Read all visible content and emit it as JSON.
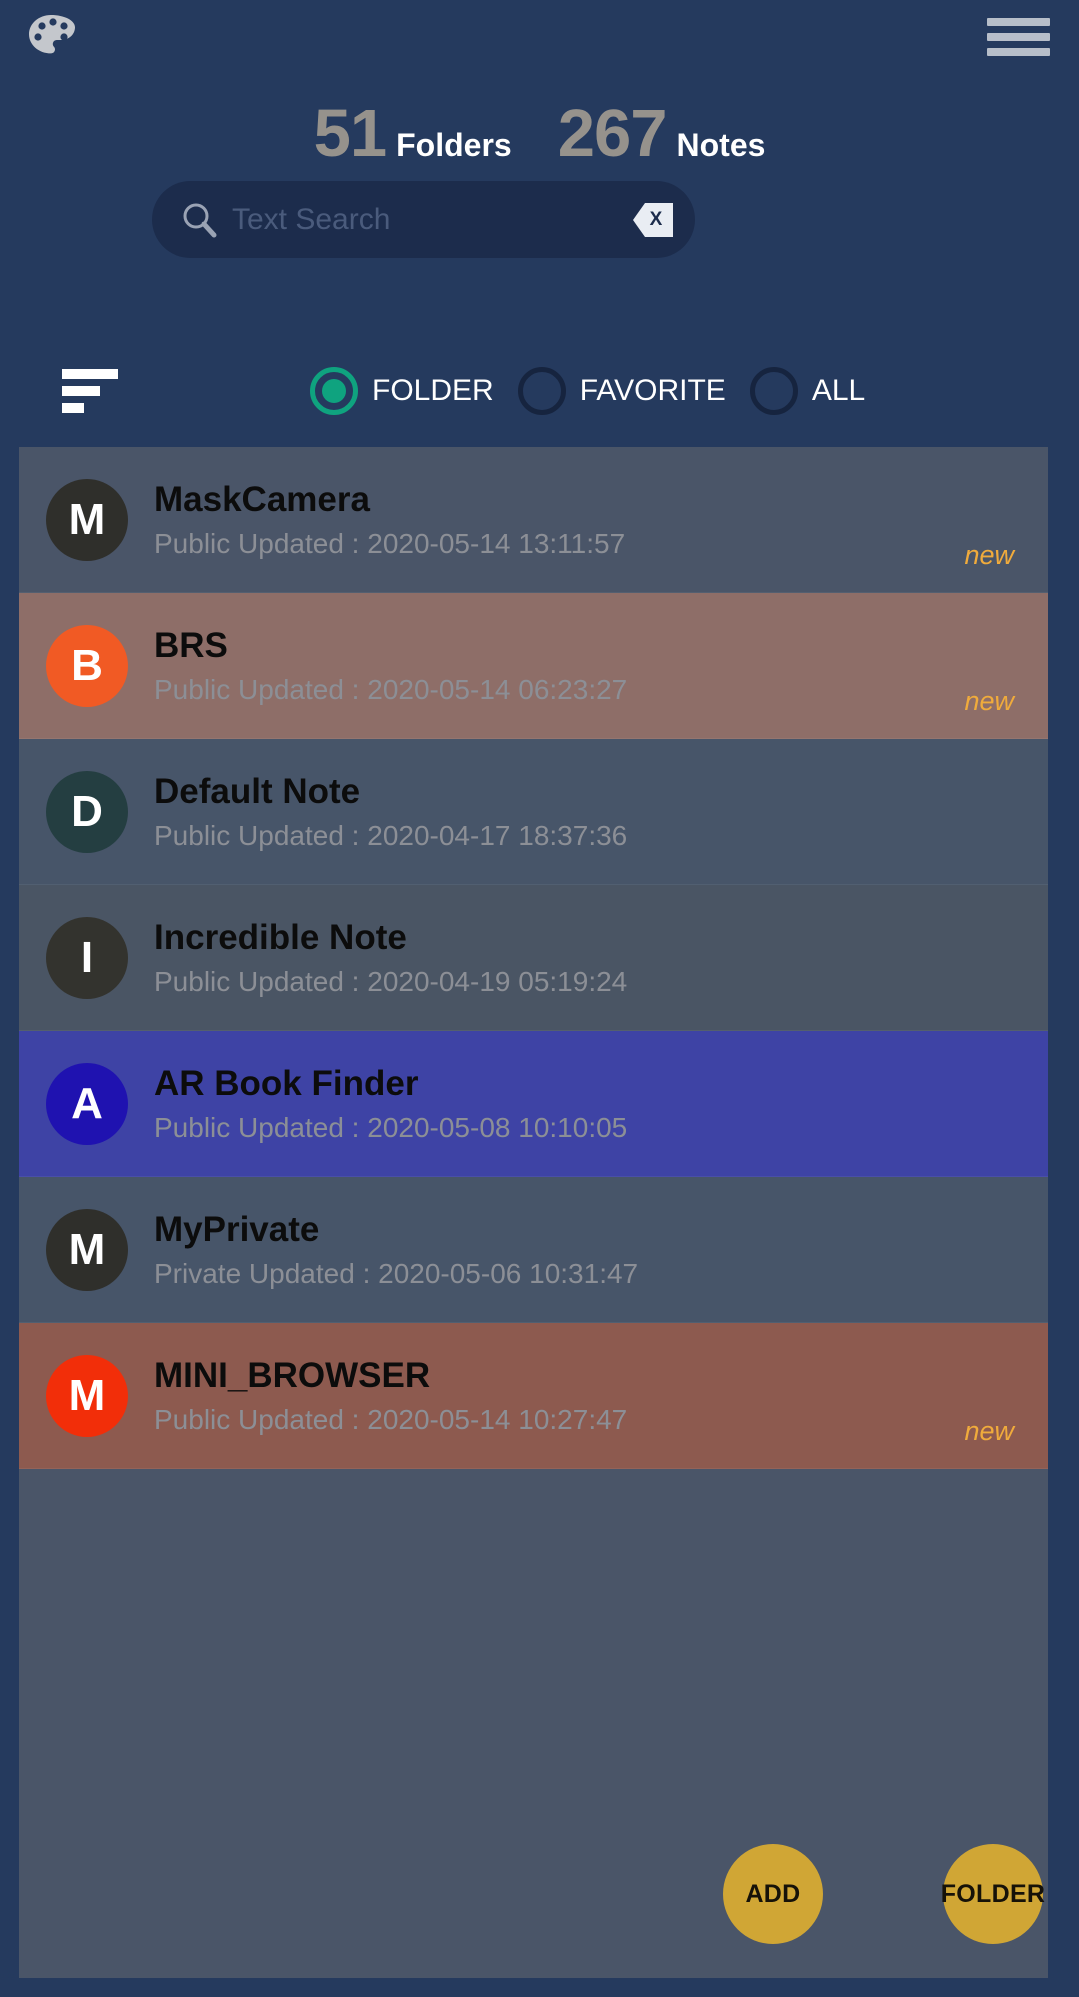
{
  "app": {
    "background_color": "#253a5e",
    "list_background_color": "#4a5568",
    "accent_color": "#0fa37f",
    "badge_color": "#f0ab3c",
    "fab_color": "#e2b22e"
  },
  "topbar": {
    "palette_icon": "palette-icon",
    "menu_icon": "hamburger-menu-icon"
  },
  "counts": {
    "folders_value": "51",
    "folders_label": "Folders",
    "notes_value": "267",
    "notes_label": "Notes"
  },
  "search": {
    "placeholder": "Text Search",
    "value": "",
    "icon": "search-icon",
    "clear_label": "X"
  },
  "filters": {
    "sort_icon": "sort-icon",
    "options": [
      {
        "label": "FOLDER",
        "selected": true
      },
      {
        "label": "FAVORITE",
        "selected": false
      },
      {
        "label": "ALL",
        "selected": false
      }
    ]
  },
  "list": {
    "items": [
      {
        "initial": "M",
        "title": "MaskCamera",
        "subtitle": "Public Updated : 2020-05-14 13:11:57",
        "badge": "new",
        "avatar_color": "#2f2f2b",
        "row_color": "#4a5568"
      },
      {
        "initial": "B",
        "title": "BRS",
        "subtitle": "Public Updated : 2020-05-14 06:23:27",
        "badge": "new",
        "avatar_color": "#f15a24",
        "row_color": "#8e6e68"
      },
      {
        "initial": "D",
        "title": "Default Note",
        "subtitle": "Public Updated : 2020-04-17 18:37:36",
        "badge": "",
        "avatar_color": "#243e41",
        "row_color": "#475569"
      },
      {
        "initial": "I",
        "title": "Incredible Note",
        "subtitle": "Public Updated : 2020-04-19 05:19:24",
        "badge": "",
        "avatar_color": "#33332e",
        "row_color": "#4a5564"
      },
      {
        "initial": "A",
        "title": "AR Book Finder",
        "subtitle": "Public Updated : 2020-05-08 10:10:05",
        "badge": "",
        "avatar_color": "#1f12b0",
        "row_color": "#3e43a5"
      },
      {
        "initial": "M",
        "title": "MyPrivate",
        "subtitle": "Private Updated : 2020-05-06 10:31:47",
        "badge": "",
        "avatar_color": "#2f2f2b",
        "row_color": "#475569"
      },
      {
        "initial": "M",
        "title": "MINI_BROWSER",
        "subtitle": "Public Updated : 2020-05-14 10:27:47",
        "badge": "new",
        "avatar_color": "#f22e09",
        "row_color": "#8d5a4f"
      }
    ]
  },
  "fabs": {
    "add_label": "ADD",
    "folder_label": "FOLDER"
  }
}
